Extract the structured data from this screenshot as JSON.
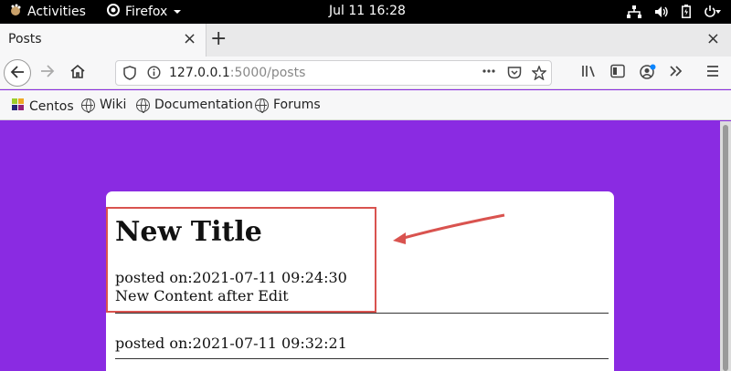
{
  "system_bar": {
    "activities_label": "Activities",
    "app_name": "Firefox",
    "clock": "Jul 11  16:28"
  },
  "tab": {
    "title": "Posts",
    "close_glyph": "×"
  },
  "toolbar": {
    "new_tab_glyph": "+",
    "window_close_glyph": "×"
  },
  "url": {
    "host": "127.0.0.1",
    "rest": ":5000/posts"
  },
  "bookmarks": [
    "Centos",
    "Wiki",
    "Documentation",
    "Forums"
  ],
  "posts": [
    {
      "title": "New Title",
      "posted": "posted on:2021-07-11 09:24:30",
      "content": "New Content after Edit"
    },
    {
      "title": "",
      "posted": "posted on:2021-07-11 09:32:21",
      "content": ""
    }
  ],
  "colors": {
    "page_background": "#8a2be2",
    "highlight": "#d9534f"
  },
  "icons": [
    "gnome-foot-icon",
    "firefox-icon",
    "network-icon",
    "volume-icon",
    "battery-icon",
    "power-icon",
    "back-icon",
    "forward-icon",
    "home-icon",
    "shield-icon",
    "info-icon",
    "more-icon",
    "pocket-icon",
    "star-icon",
    "library-icon",
    "sidebar-icon",
    "account-icon",
    "overflow-icon",
    "menu-icon",
    "globe-icon",
    "arrow-annotation"
  ]
}
